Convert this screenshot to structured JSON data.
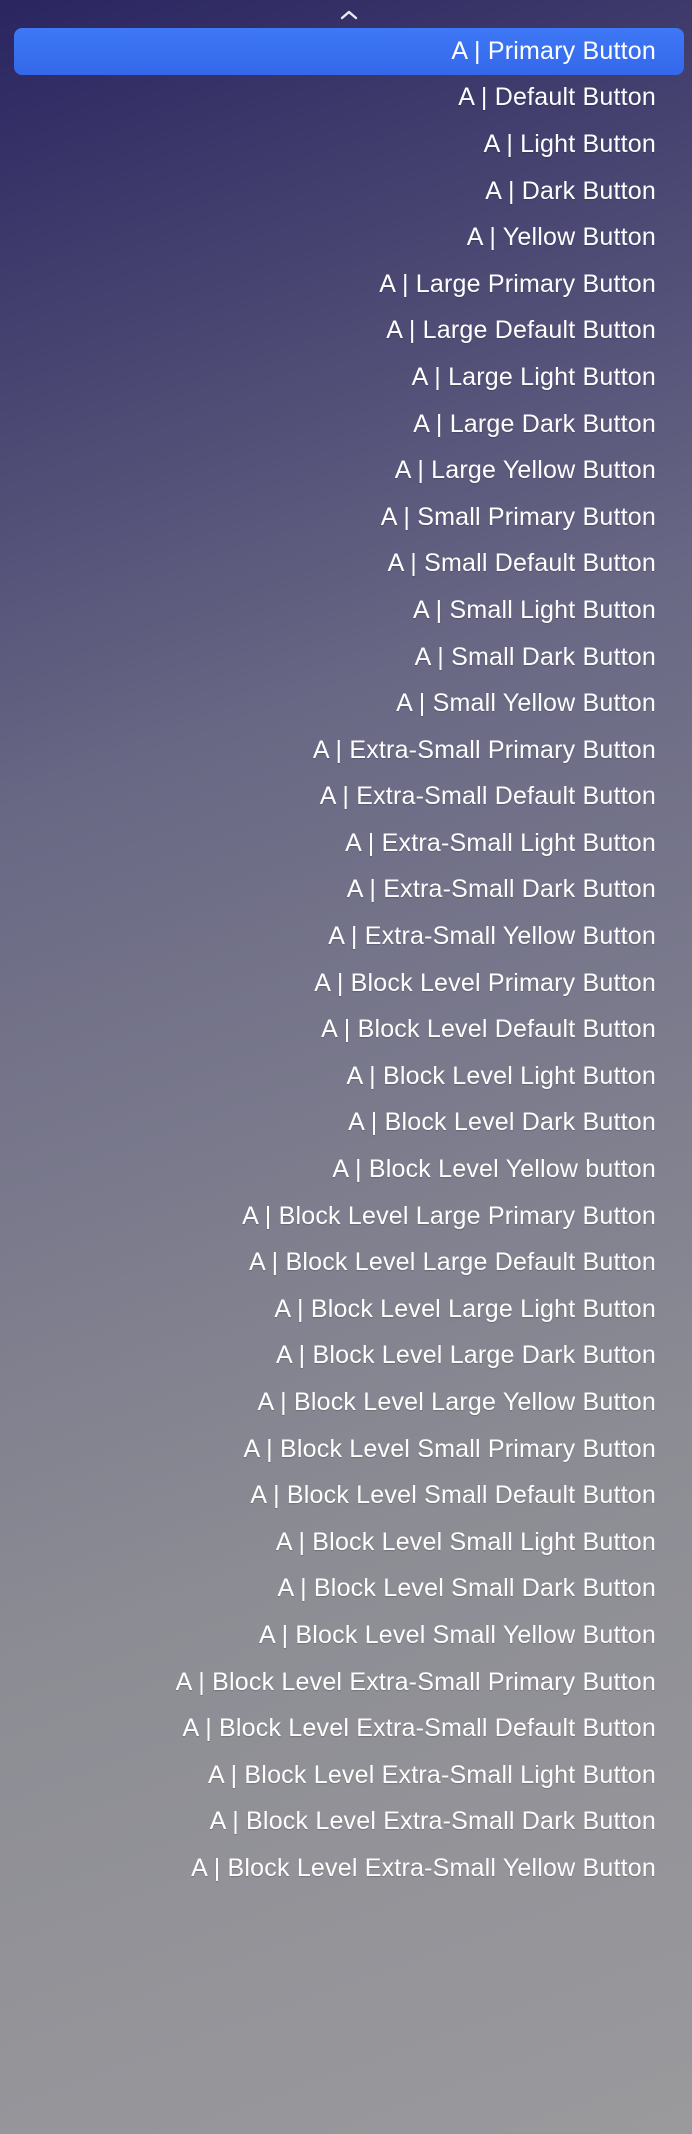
{
  "menu": {
    "scroll_up_icon": "chevron-up",
    "selected_index": 0,
    "items": [
      {
        "label": "A | Primary Button"
      },
      {
        "label": "A | Default Button"
      },
      {
        "label": "A | Light Button"
      },
      {
        "label": "A | Dark Button"
      },
      {
        "label": "A | Yellow Button"
      },
      {
        "label": "A | Large Primary Button"
      },
      {
        "label": "A | Large Default Button"
      },
      {
        "label": "A | Large Light Button"
      },
      {
        "label": "A | Large Dark Button"
      },
      {
        "label": "A | Large Yellow Button"
      },
      {
        "label": "A | Small Primary Button"
      },
      {
        "label": "A | Small Default Button"
      },
      {
        "label": "A | Small Light Button"
      },
      {
        "label": "A | Small Dark Button"
      },
      {
        "label": "A | Small Yellow Button"
      },
      {
        "label": "A | Extra-Small Primary Button"
      },
      {
        "label": "A | Extra-Small Default Button"
      },
      {
        "label": "A | Extra-Small Light Button"
      },
      {
        "label": "A | Extra-Small Dark Button"
      },
      {
        "label": "A | Extra-Small Yellow Button"
      },
      {
        "label": "A | Block Level Primary Button"
      },
      {
        "label": "A | Block Level Default Button"
      },
      {
        "label": "A | Block Level Light Button"
      },
      {
        "label": "A | Block Level Dark Button"
      },
      {
        "label": "A | Block Level Yellow button"
      },
      {
        "label": "A | Block Level Large Primary Button"
      },
      {
        "label": "A | Block Level Large Default Button"
      },
      {
        "label": "A | Block Level Large Light Button"
      },
      {
        "label": "A | Block Level Large Dark Button"
      },
      {
        "label": "A | Block Level Large Yellow Button"
      },
      {
        "label": "A | Block Level Small Primary Button"
      },
      {
        "label": "A | Block Level Small Default Button"
      },
      {
        "label": "A | Block Level Small Light Button"
      },
      {
        "label": "A | Block Level Small Dark Button"
      },
      {
        "label": "A | Block Level Small Yellow Button"
      },
      {
        "label": "A | Block Level Extra-Small Primary Button"
      },
      {
        "label": "A | Block Level Extra-Small Default Button"
      },
      {
        "label": "A | Block Level Extra-Small Light Button"
      },
      {
        "label": "A | Block Level Extra-Small Dark Button"
      },
      {
        "label": "A | Block Level Extra-Small Yellow Button"
      }
    ]
  }
}
